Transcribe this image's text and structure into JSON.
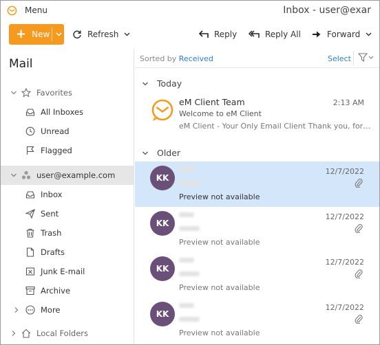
{
  "titlebar": {
    "menu_label": "Menu",
    "window_title": "Inbox - user@exar"
  },
  "toolbar": {
    "new_label": "New",
    "refresh_label": "Refresh",
    "reply_label": "Reply",
    "reply_all_label": "Reply All",
    "forward_label": "Forward"
  },
  "nav": {
    "header": "Mail",
    "favorites": {
      "label": "Favorites",
      "items": [
        {
          "label": "All Inboxes",
          "icon": "inbox-icon"
        },
        {
          "label": "Unread",
          "icon": "clock-icon"
        },
        {
          "label": "Flagged",
          "icon": "flag-icon"
        }
      ]
    },
    "account": {
      "label": "user@example.com",
      "items": [
        {
          "label": "Inbox",
          "icon": "inbox-icon"
        },
        {
          "label": "Sent",
          "icon": "send-icon"
        },
        {
          "label": "Trash",
          "icon": "trash-icon"
        },
        {
          "label": "Drafts",
          "icon": "draft-icon"
        },
        {
          "label": "Junk E-mail",
          "icon": "junk-icon"
        },
        {
          "label": "Archive",
          "icon": "archive-icon"
        },
        {
          "label": "More",
          "icon": "more-icon"
        }
      ]
    },
    "local_folders": "Local Folders"
  },
  "list": {
    "sorted_by_label": "Sorted by",
    "sorted_by_value": "Received",
    "select_label": "Select",
    "groups": [
      {
        "label": "Today",
        "messages": [
          {
            "from": "eM Client Team",
            "subject": "Welcome to eM Client",
            "preview": "eM Client - Your Only Email Client Thank you, for ch...",
            "date": "2:13 AM",
            "icon": "emclient-logo-icon"
          }
        ]
      },
      {
        "label": "Older",
        "messages": [
          {
            "avatar": "KK",
            "preview": "Preview not available",
            "date": "12/7/2022",
            "selected": true
          },
          {
            "avatar": "KK",
            "preview": "Preview not available",
            "date": "12/7/2022"
          },
          {
            "avatar": "KK",
            "preview": "Preview not available",
            "date": "12/7/2022"
          },
          {
            "avatar": "KK",
            "preview": "Preview not available",
            "date": "12/7/2022"
          }
        ]
      }
    ]
  },
  "colors": {
    "accent": "#f59a1e",
    "link": "#2a7fd4",
    "selection": "#d4e6f9",
    "avatar": "#6a4f78"
  }
}
